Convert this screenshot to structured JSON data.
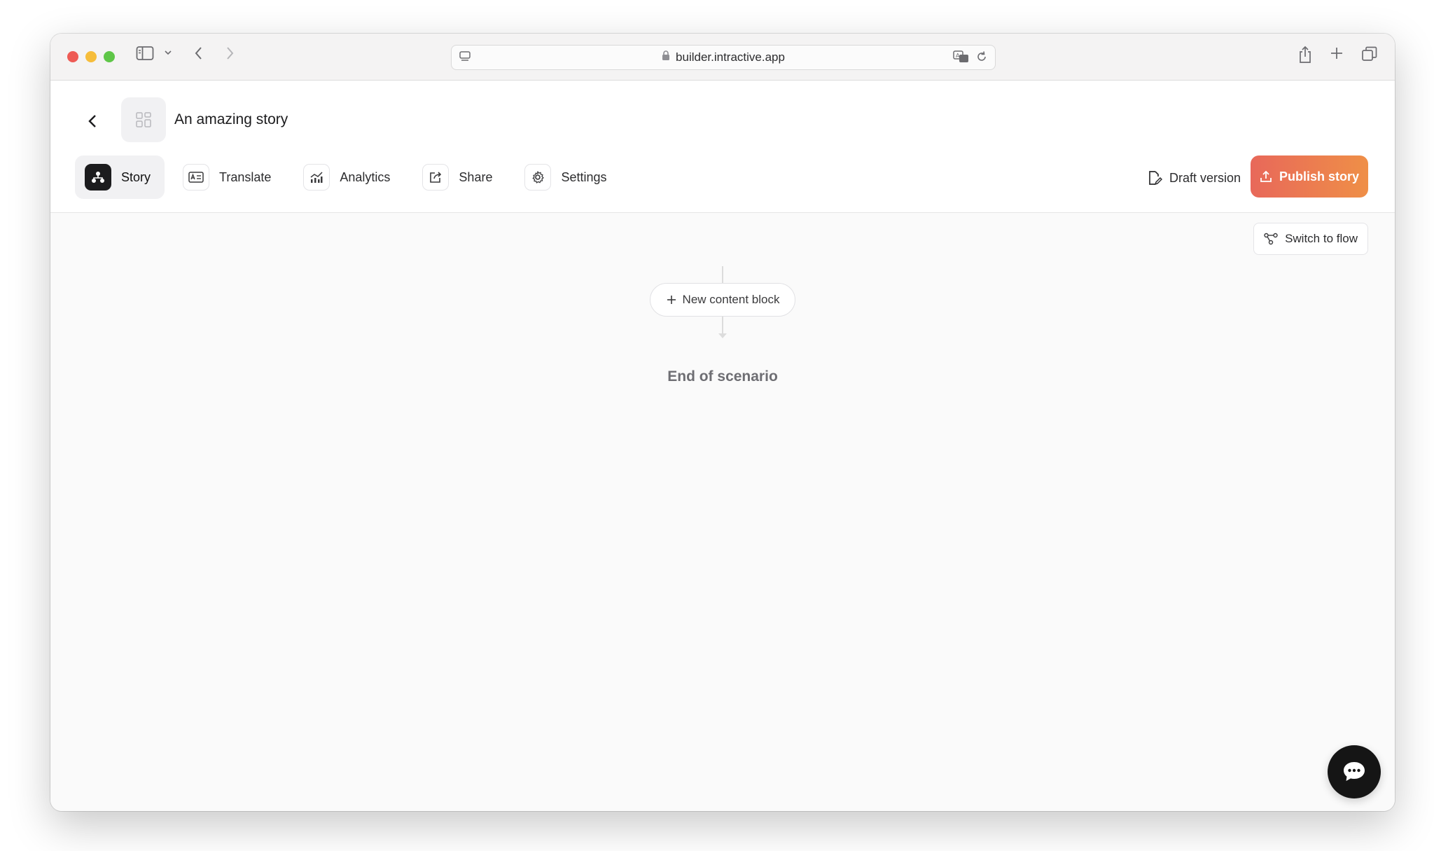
{
  "browser": {
    "url": "builder.intractive.app"
  },
  "header": {
    "story_title": "An amazing story",
    "tabs": [
      {
        "label": "Story",
        "icon": "sitemap-icon",
        "active": true
      },
      {
        "label": "Translate",
        "icon": "translate-card-icon",
        "active": false
      },
      {
        "label": "Analytics",
        "icon": "analytics-chart-icon",
        "active": false
      },
      {
        "label": "Share",
        "icon": "share-icon",
        "active": false
      },
      {
        "label": "Settings",
        "icon": "gear-icon",
        "active": false
      }
    ],
    "draft_label": "Draft version",
    "publish_label": "Publish story",
    "publish_colors": [
      "#e8685a",
      "#ef8f47"
    ]
  },
  "canvas": {
    "switch_label": "Switch to flow",
    "new_block_label": "New content block",
    "end_label": "End of scenario"
  }
}
